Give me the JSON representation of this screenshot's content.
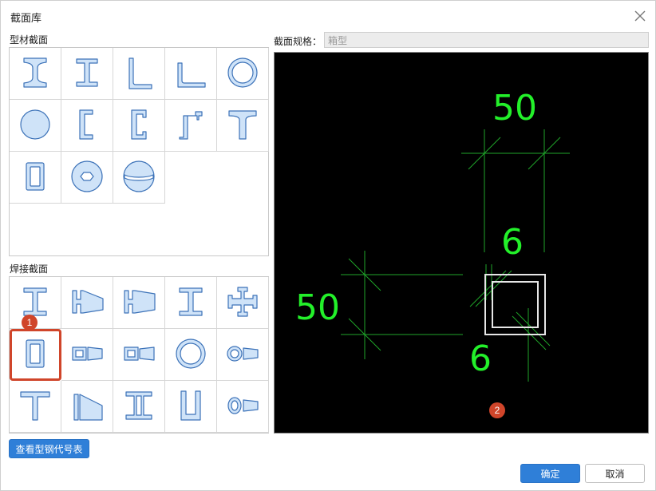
{
  "dialog": {
    "title": "截面库",
    "close_icon": "close-icon"
  },
  "profile_section": {
    "label": "型材截面",
    "items": [
      {
        "icon": "i-beam-icon"
      },
      {
        "icon": "h-beam-icon"
      },
      {
        "icon": "equal-angle-icon"
      },
      {
        "icon": "unequal-angle-icon"
      },
      {
        "icon": "circular-tube-icon"
      },
      {
        "icon": "solid-circle-icon"
      },
      {
        "icon": "channel-icon"
      },
      {
        "icon": "lipped-channel-icon"
      },
      {
        "icon": "z-section-icon"
      },
      {
        "icon": "t-section-icon"
      },
      {
        "icon": "rectangular-tube-icon"
      },
      {
        "icon": "hexagon-hole-disc-icon"
      },
      {
        "icon": "split-sphere-icon"
      }
    ]
  },
  "welded_section": {
    "label": "焊接截面",
    "items": [
      {
        "icon": "welded-i-beam-icon"
      },
      {
        "icon": "welded-tapered-i-icon"
      },
      {
        "icon": "welded-tapered-i-reverse-icon"
      },
      {
        "icon": "welded-h-beam-icon"
      },
      {
        "icon": "welded-cross-icon"
      },
      {
        "icon": "welded-box-icon"
      },
      {
        "icon": "welded-box-tapered-icon"
      },
      {
        "icon": "welded-box-tapered-2-icon"
      },
      {
        "icon": "welded-circular-tube-icon"
      },
      {
        "icon": "welded-tube-tapered-icon"
      },
      {
        "icon": "welded-t-icon"
      },
      {
        "icon": "welded-tapered-t-icon"
      },
      {
        "icon": "welded-double-i-icon"
      },
      {
        "icon": "welded-u-icon"
      },
      {
        "icon": "welded-tube-tapered-2-icon"
      }
    ],
    "selected_index": 5
  },
  "badges": {
    "one": "1",
    "two": "2"
  },
  "spec": {
    "label": "截面规格：",
    "value": "箱型"
  },
  "preview": {
    "dim_top": "50",
    "dim_thickness_top": "6",
    "dim_left": "50",
    "dim_thickness_bottom": "6"
  },
  "buttons": {
    "lookup": "查看型钢代号表",
    "ok": "确定",
    "cancel": "取消"
  },
  "colors": {
    "accent": "#2f7fd8",
    "highlight": "#d0452a",
    "dim_green": "#23f02a",
    "icon_fill": "#cfe3f8",
    "icon_stroke": "#3c72b8"
  }
}
